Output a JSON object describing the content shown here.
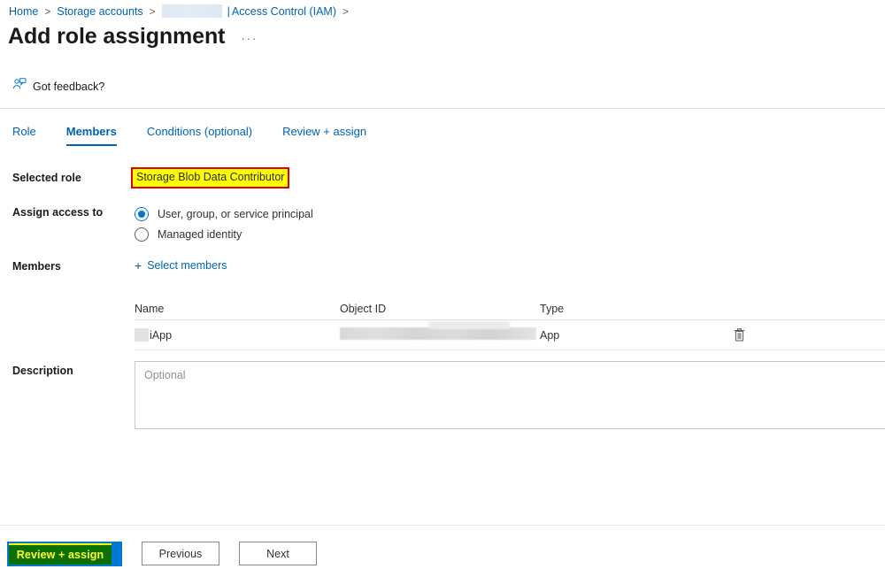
{
  "breadcrumb": {
    "home": "Home",
    "storage_accounts": "Storage accounts",
    "redacted_account": "",
    "pipe": "|",
    "access_control": "Access Control (IAM)",
    "separator": ">"
  },
  "header": {
    "title": "Add role assignment",
    "ellipsis": "···"
  },
  "feedback": {
    "label": "Got feedback?",
    "icon": "feedback-person-icon"
  },
  "tabs": [
    {
      "label": "Role",
      "active": false
    },
    {
      "label": "Members",
      "active": true
    },
    {
      "label": "Conditions (optional)",
      "active": false
    },
    {
      "label": "Review + assign",
      "active": false
    }
  ],
  "form": {
    "selected_role": {
      "label": "Selected role",
      "value": "Storage Blob Data Contributor",
      "highlight_fill": "#ffff00",
      "highlight_border": "#e00000"
    },
    "assign_access_to": {
      "label": "Assign access to",
      "options": [
        {
          "label": "User, group, or service principal",
          "selected": true
        },
        {
          "label": "Managed identity",
          "selected": false
        }
      ]
    },
    "members": {
      "label": "Members",
      "select_members_label": "Select members",
      "plus_icon": "+",
      "table": {
        "columns": [
          "Name",
          "Object ID",
          "Type"
        ],
        "rows": [
          {
            "name": "iApp",
            "name_redacted": true,
            "object_id": "",
            "object_id_redacted": true,
            "type": "App",
            "action_icon": "trash-icon"
          }
        ]
      }
    },
    "description": {
      "label": "Description",
      "placeholder": "Optional",
      "value": ""
    }
  },
  "footer": {
    "primary_label": "Review + assign",
    "primary_color": "#0078d4",
    "primary_annotation_fill": "#0c7000",
    "primary_annotation_text_color": "#ffff33",
    "previous_label": "Previous",
    "next_label": "Next"
  },
  "theme": {
    "link_blue": "#0063b1",
    "accent_blue": "#0078d4",
    "text_dark": "#1b1a19"
  }
}
